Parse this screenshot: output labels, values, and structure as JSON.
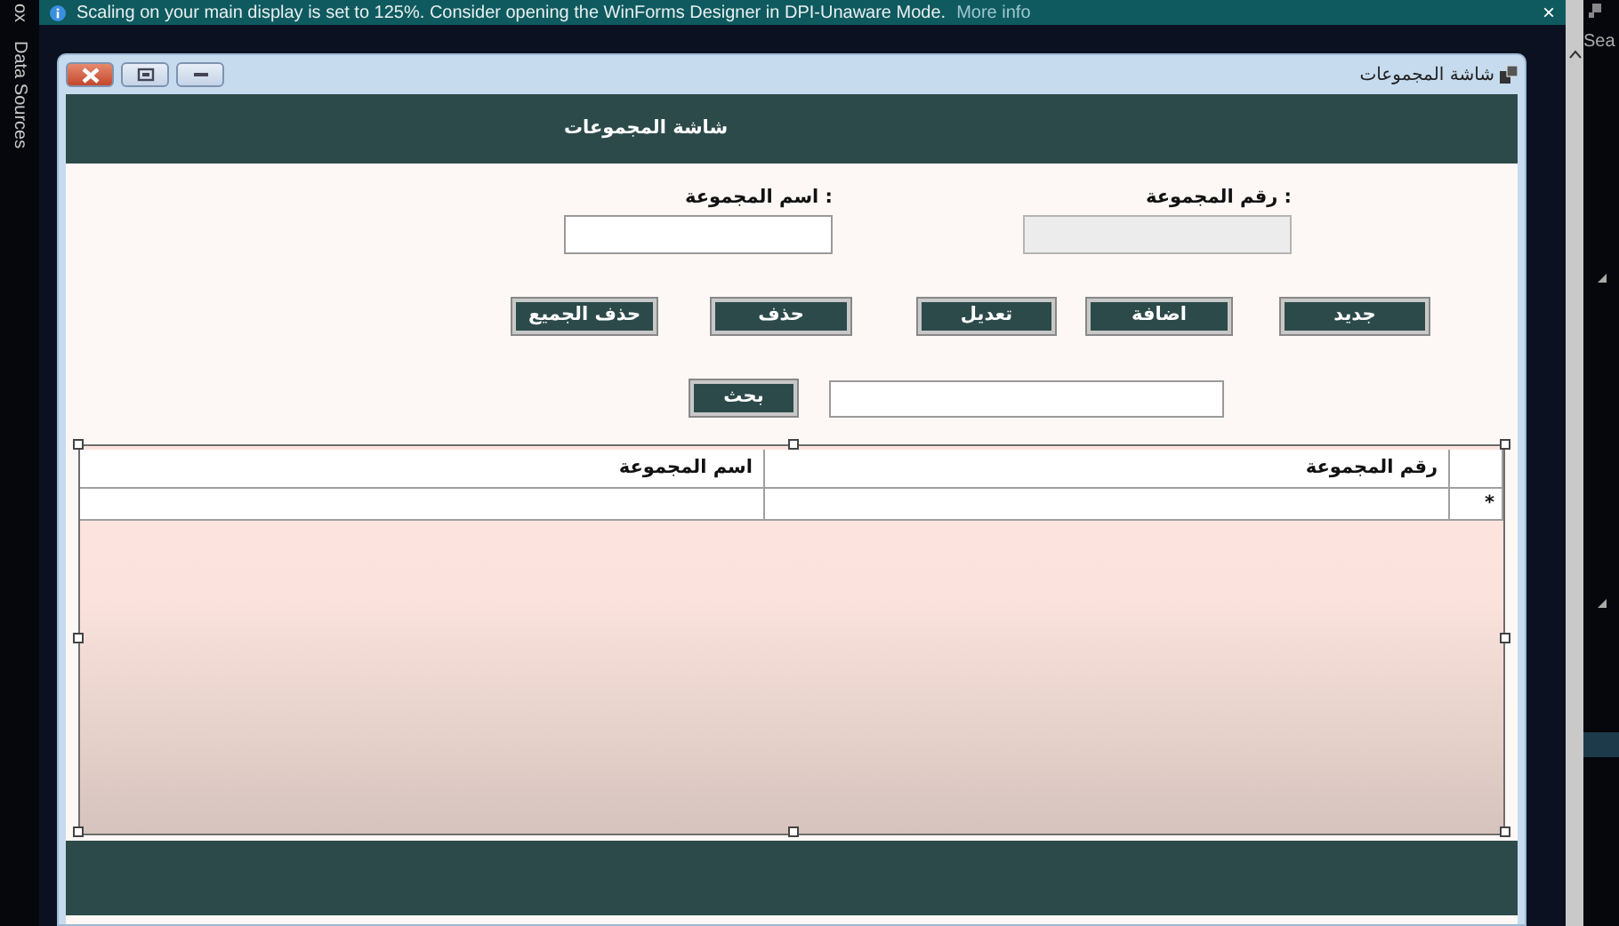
{
  "notification": {
    "message": "Scaling on your main display is set to 125%. Consider opening the WinForms Designer in DPI-Unaware Mode.",
    "link": "More info",
    "close": "×"
  },
  "left_panel": {
    "tabs": [
      "ox",
      "Data Sources"
    ]
  },
  "right_panel": {
    "search": "Sea"
  },
  "window": {
    "title": "شاشة المجموعات"
  },
  "form": {
    "header": "شاشة المجموعات",
    "fields": [
      {
        "label": "رقم المجموعة :",
        "disabled": true
      },
      {
        "label": "اسم المجموعة :",
        "disabled": false
      }
    ],
    "buttons": [
      "جديد",
      "اضافة",
      "تعديل",
      "حذف",
      "حذف الجميع"
    ],
    "search_button": "بحث",
    "grid": {
      "columns": [
        "رقم المجموعة",
        "اسم المجموعة"
      ],
      "new_row_marker": "*"
    }
  }
}
